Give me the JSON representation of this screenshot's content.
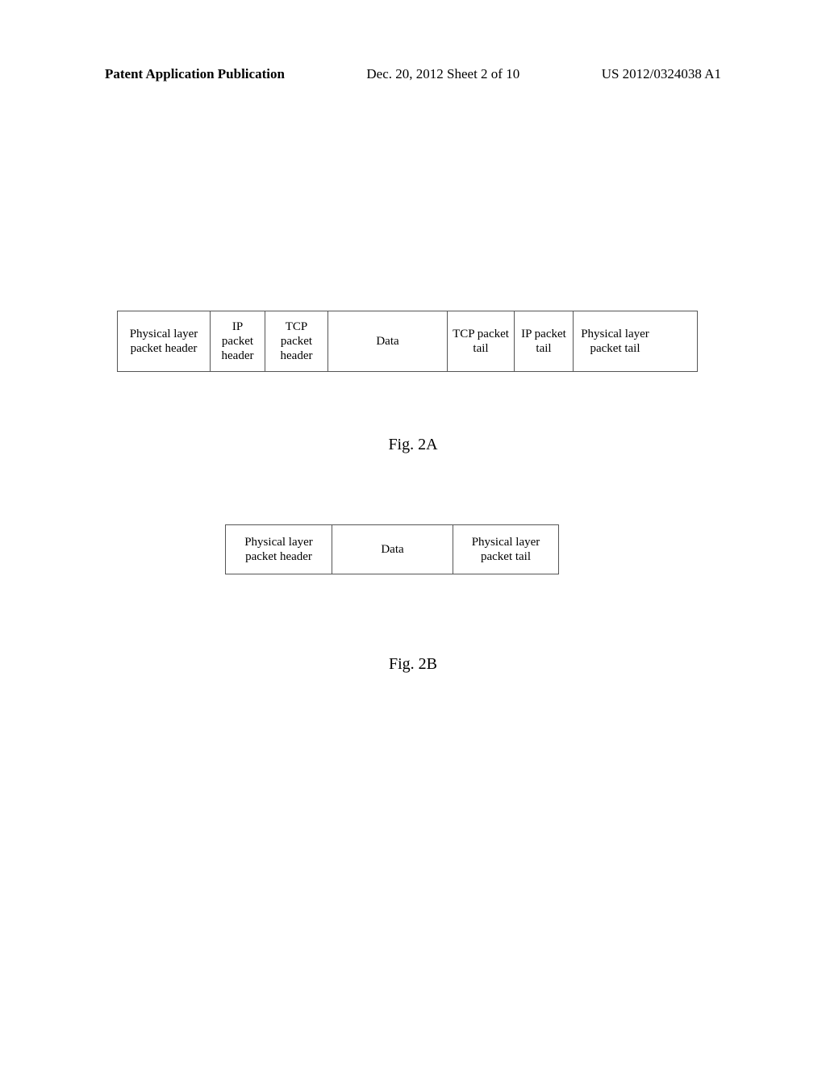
{
  "header": {
    "left": "Patent Application Publication",
    "center": "Dec. 20, 2012  Sheet 2 of 10",
    "right": "US 2012/0324038 A1"
  },
  "fig2a": {
    "cells": {
      "phys_header_l1": "Physical layer",
      "phys_header_l2": "packet header",
      "ip_header_l1": "IP packet",
      "ip_header_l2": "header",
      "tcp_header_l1": "TCP packet",
      "tcp_header_l2": "header",
      "data": "Data",
      "tcp_tail_l1": "TCP packet",
      "tcp_tail_l2": "tail",
      "ip_tail_l1": "IP packet",
      "ip_tail_l2": "tail",
      "phys_tail_l1": "Physical layer",
      "phys_tail_l2": "packet tail"
    },
    "caption": "Fig.  2A"
  },
  "fig2b": {
    "cells": {
      "phys_header_l1": "Physical layer",
      "phys_header_l2": "packet header",
      "data": "Data",
      "phys_tail_l1": "Physical layer",
      "phys_tail_l2": "packet tail"
    },
    "caption": "Fig.  2B"
  },
  "chart_data": [
    {
      "type": "table",
      "title": "Fig. 2A",
      "columns": [
        "Physical layer packet header",
        "IP packet header",
        "TCP packet header",
        "Data",
        "TCP packet tail",
        "IP packet tail",
        "Physical layer packet tail"
      ]
    },
    {
      "type": "table",
      "title": "Fig. 2B",
      "columns": [
        "Physical layer packet header",
        "Data",
        "Physical layer packet tail"
      ]
    }
  ]
}
